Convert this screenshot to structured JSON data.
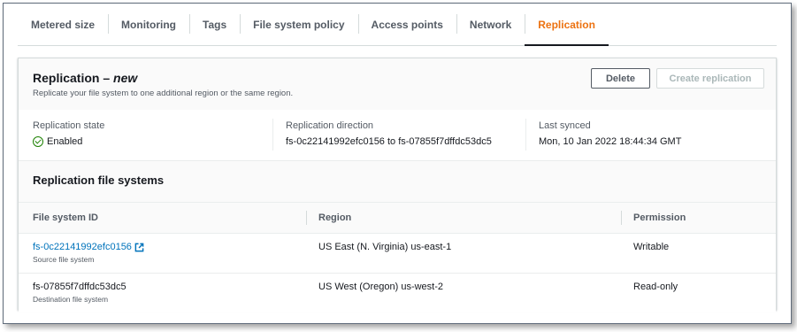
{
  "tabs": [
    {
      "label": "Metered size",
      "active": false
    },
    {
      "label": "Monitoring",
      "active": false
    },
    {
      "label": "Tags",
      "active": false
    },
    {
      "label": "File system policy",
      "active": false
    },
    {
      "label": "Access points",
      "active": false
    },
    {
      "label": "Network",
      "active": false
    },
    {
      "label": "Replication",
      "active": true
    }
  ],
  "header": {
    "title": "Replication",
    "title_sep": " – ",
    "title_badge": "new",
    "subtitle": "Replicate your file system to one additional region or the same region.",
    "delete_label": "Delete",
    "create_label": "Create replication"
  },
  "summary": {
    "state_label": "Replication state",
    "state_value": "Enabled",
    "direction_label": "Replication direction",
    "direction_value": "fs-0c22141992efc0156 to fs-07855f7dffdc53dc5",
    "synced_label": "Last synced",
    "synced_value": "Mon, 10 Jan 2022 18:44:34 GMT"
  },
  "table": {
    "title": "Replication file systems",
    "columns": [
      "File system ID",
      "Region",
      "Permission"
    ],
    "rows": [
      {
        "id": "fs-0c22141992efc0156",
        "id_sub": "Source file system",
        "region": "US East (N. Virginia) us-east-1",
        "permission": "Writable",
        "link": true
      },
      {
        "id": "fs-07855f7dffdc53dc5",
        "id_sub": "Destination file system",
        "region": "US West (Oregon) us-west-2",
        "permission": "Read-only",
        "link": false
      }
    ]
  },
  "colors": {
    "accent": "#ec7211",
    "link": "#0073bb",
    "success": "#1d8102"
  },
  "icons": {
    "status": "check-circle-icon",
    "external": "external-link-icon"
  }
}
